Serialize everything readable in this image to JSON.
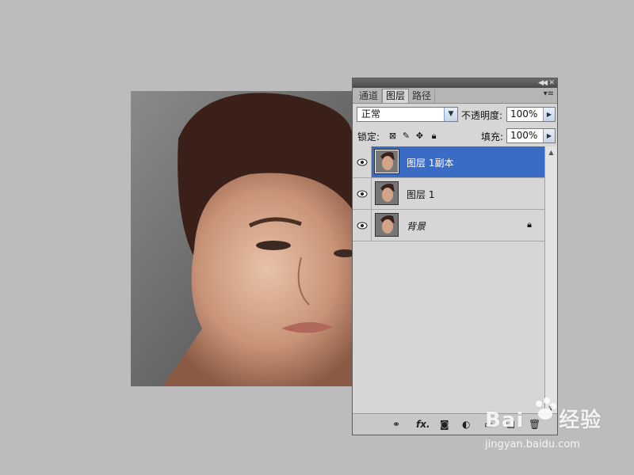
{
  "panel": {
    "tabs": [
      {
        "label": "通道"
      },
      {
        "label": "图层"
      },
      {
        "label": "路径"
      }
    ],
    "blend_mode": "正常",
    "opacity_label": "不透明度:",
    "opacity_value": "100%",
    "lock_label": "锁定:",
    "fill_label": "填充:",
    "fill_value": "100%",
    "layers": [
      {
        "name": "图层 1副本",
        "selected": true
      },
      {
        "name": "图层 1",
        "selected": false
      },
      {
        "name": "背景",
        "selected": false,
        "locked": true
      }
    ],
    "footer_icons": [
      "link-icon",
      "fx-icon",
      "mask-icon",
      "adjustment-icon",
      "group-icon",
      "new-layer-icon",
      "trash-icon"
    ],
    "fx_label": "fx."
  },
  "watermark": {
    "brand": "Bai",
    "brand2": "经验",
    "url": "jingyan.baidu.com"
  },
  "colors": {
    "selection": "#3a6cc6",
    "background": "#bcbcbc"
  }
}
